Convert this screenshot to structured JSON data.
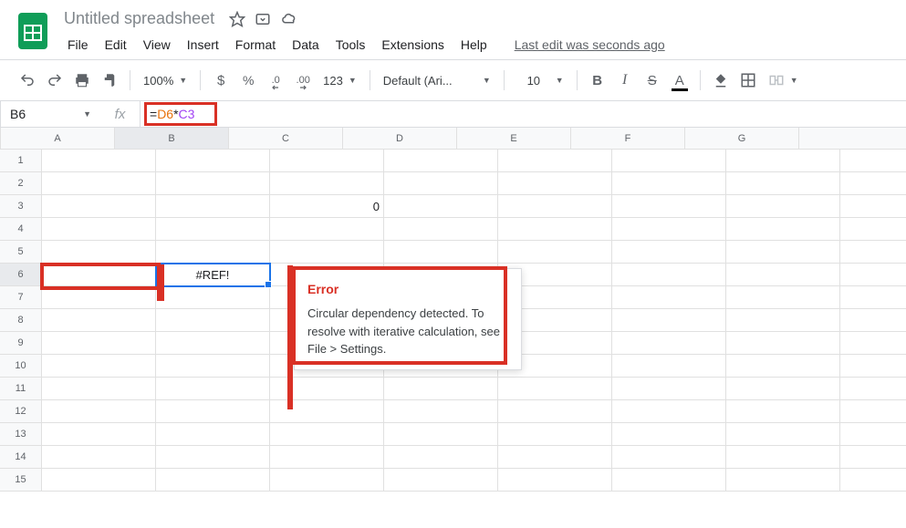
{
  "doc": {
    "title": "Untitled spreadsheet"
  },
  "menubar": {
    "file": "File",
    "edit": "Edit",
    "view": "View",
    "insert": "Insert",
    "format": "Format",
    "data": "Data",
    "tools": "Tools",
    "extensions": "Extensions",
    "help": "Help",
    "last_edit": "Last edit was seconds ago"
  },
  "toolbar": {
    "zoom": "100%",
    "currency": "$",
    "percent": "%",
    "dec_dec": ".0",
    "inc_dec": ".00",
    "more_fmt": "123",
    "font": "Default (Ari...",
    "font_size": "10",
    "bold": "B",
    "italic": "I",
    "strike": "S",
    "text_color": "A"
  },
  "formula": {
    "name_box": "B6",
    "fx": "fx",
    "eq": "=",
    "ref1": "D6",
    "star": "*",
    "ref2": "C3"
  },
  "columns": [
    "A",
    "B",
    "C",
    "D",
    "E",
    "F",
    "G"
  ],
  "active_col": "B",
  "active_row": 6,
  "row_count": 15,
  "cells": {
    "C3": "0",
    "B6": "#REF!"
  },
  "error_tooltip": {
    "title": "Error",
    "body": "Circular dependency detected. To resolve with iterative calculation, see File > Settings."
  },
  "icons": {
    "star": "star-icon",
    "move": "move-icon",
    "cloud": "cloud-icon",
    "undo": "undo-icon",
    "redo": "redo-icon",
    "print": "print-icon",
    "paint": "paint-format-icon",
    "fill": "fill-color-icon",
    "borders": "borders-icon",
    "merge": "merge-icon"
  }
}
